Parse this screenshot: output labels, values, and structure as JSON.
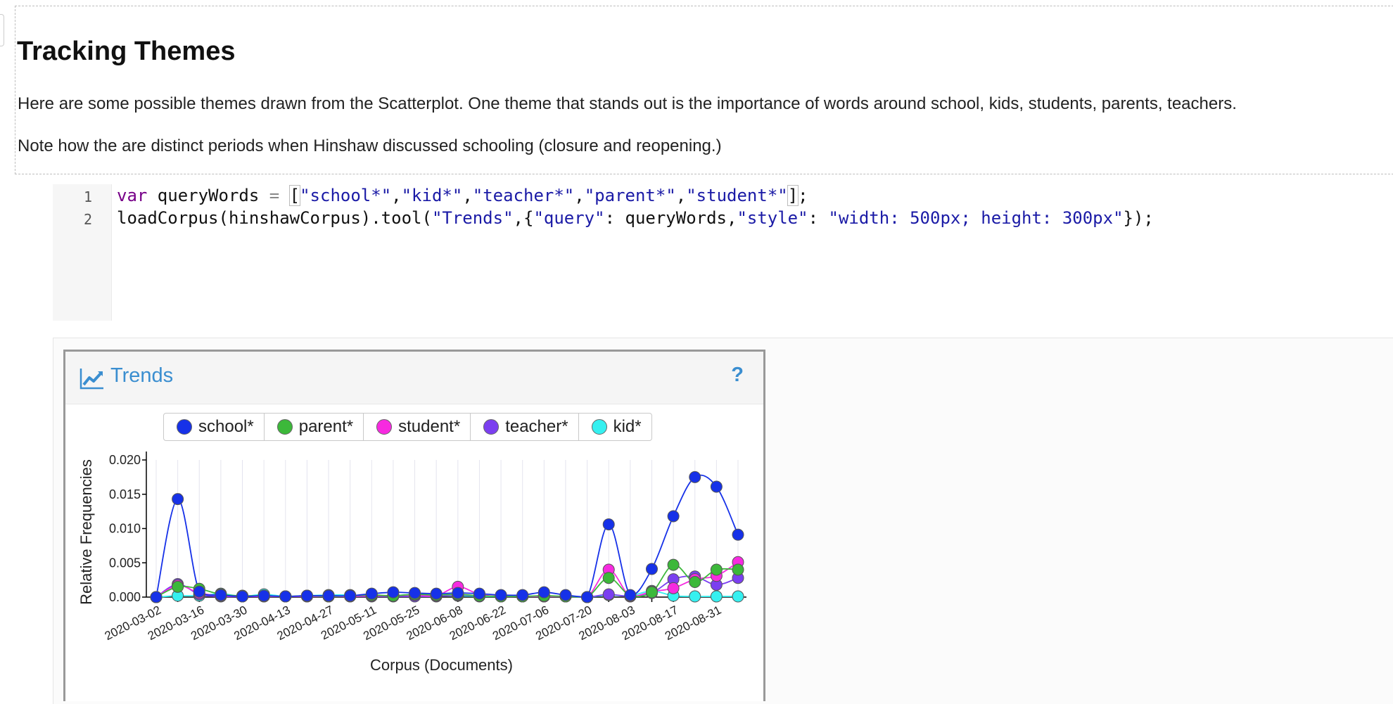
{
  "text_cell": {
    "title": "Tracking Themes",
    "para1": "Here are some possible themes drawn from the Scatterplot. One theme that stands out is the importance of words around school, kids, students, parents, teachers.",
    "para2": "Note how the are distinct periods when Hinshaw discussed schooling (closure and reopening.)"
  },
  "code_cell": {
    "line_numbers": [
      "1",
      "2"
    ],
    "line1": {
      "kw": "var",
      "ident": " queryWords ",
      "op": "=",
      "sp": " ",
      "lb": "[",
      "s1": "\"school*\"",
      "c1": ",",
      "s2": "\"kid*\"",
      "c2": ",",
      "s3": "\"teacher*\"",
      "c3": ",",
      "s4": "\"parent*\"",
      "c4": ",",
      "s5": "\"student*\"",
      "rb": "]",
      "end": ";"
    },
    "line2": {
      "a": "loadCorpus(hinshawCorpus).tool(",
      "s1": "\"Trends\"",
      "b": ",{",
      "s2": "\"query\"",
      "c": ": queryWords,",
      "s3": "\"style\"",
      "d": ": ",
      "s4": "\"width: 500px; height: 300px\"",
      "e": "});"
    }
  },
  "panel": {
    "title": "Trends",
    "help": "?",
    "icon": "trend-line-icon"
  },
  "colors": {
    "accent": "#3a8ed0",
    "school": "#1631e8",
    "parent": "#3cb83a",
    "student": "#f72ae0",
    "teacher": "#7b3ff0",
    "kid": "#35f0f0"
  },
  "chart_data": {
    "type": "line",
    "xlabel": "Corpus (Documents)",
    "ylabel": "Relative Frequencies",
    "ylim": [
      0,
      0.02
    ],
    "yticks": [
      "0.000",
      "0.005",
      "0.010",
      "0.015",
      "0.020"
    ],
    "xtick_labels": [
      "2020-03-02",
      "2020-03-16",
      "2020-03-30",
      "2020-04-13",
      "2020-04-27",
      "2020-05-11",
      "2020-05-25",
      "2020-06-08",
      "2020-06-22",
      "2020-07-06",
      "2020-07-20",
      "2020-08-03",
      "2020-08-17",
      "2020-08-31"
    ],
    "x": [
      1,
      2,
      3,
      4,
      5,
      6,
      7,
      8,
      9,
      10,
      11,
      12,
      13,
      14,
      15,
      16,
      17,
      18,
      19,
      20,
      21,
      22,
      23,
      24,
      25,
      26,
      27,
      28
    ],
    "legend_position": "top",
    "series": [
      {
        "name": "school*",
        "color": "#1631e8",
        "values": [
          0.0,
          0.0143,
          0.0008,
          0.0003,
          0.0001,
          0.0002,
          0.0001,
          0.0002,
          0.0002,
          0.0002,
          0.0005,
          0.0007,
          0.0006,
          0.0005,
          0.0006,
          0.0005,
          0.0003,
          0.0003,
          0.0007,
          0.0003,
          0.0,
          0.0106,
          0.0003,
          0.0041,
          0.0118,
          0.0175,
          0.0161,
          0.0091
        ]
      },
      {
        "name": "parent*",
        "color": "#3cb83a",
        "values": [
          0.0,
          0.0015,
          0.0012,
          0.0004,
          0.0002,
          0.0002,
          0.0001,
          0.0002,
          0.0001,
          0.0002,
          0.0003,
          0.0002,
          0.0004,
          0.0003,
          0.0004,
          0.0002,
          0.0001,
          0.0001,
          0.0002,
          0.0001,
          0.0,
          0.0028,
          0.0002,
          0.0007,
          0.0047,
          0.0022,
          0.004,
          0.004
        ]
      },
      {
        "name": "student*",
        "color": "#f72ae0",
        "values": [
          0.0,
          0.0017,
          0.0006,
          0.0002,
          0.0001,
          0.0001,
          0.0001,
          0.0001,
          0.0001,
          0.0001,
          0.0002,
          0.0002,
          0.0003,
          0.0002,
          0.0015,
          0.0004,
          0.0001,
          0.0001,
          0.0001,
          0.0001,
          0.0,
          0.004,
          0.0001,
          0.0008,
          0.0013,
          0.0026,
          0.0031,
          0.0051
        ]
      },
      {
        "name": "teacher*",
        "color": "#7b3ff0",
        "values": [
          0.0,
          0.0019,
          0.0004,
          0.0001,
          0.0001,
          0.0001,
          0.0001,
          0.0001,
          0.0001,
          0.0001,
          0.0001,
          0.0001,
          0.0001,
          0.0001,
          0.0003,
          0.0002,
          0.0001,
          0.0001,
          0.0001,
          0.0001,
          0.0,
          0.0004,
          0.0001,
          0.0006,
          0.0026,
          0.003,
          0.0018,
          0.0028
        ]
      },
      {
        "name": "kid*",
        "color": "#35f0f0",
        "values": [
          0.0,
          0.0002,
          0.0002,
          0.0005,
          0.0001,
          0.0004,
          0.0001,
          0.0002,
          0.0003,
          0.0003,
          0.0002,
          0.0002,
          0.0004,
          0.0002,
          0.0002,
          0.0001,
          0.0001,
          0.0001,
          0.0001,
          0.0001,
          0.0,
          0.0003,
          0.0002,
          0.0009,
          0.0002,
          0.0001,
          0.0001,
          0.0001
        ]
      }
    ]
  }
}
